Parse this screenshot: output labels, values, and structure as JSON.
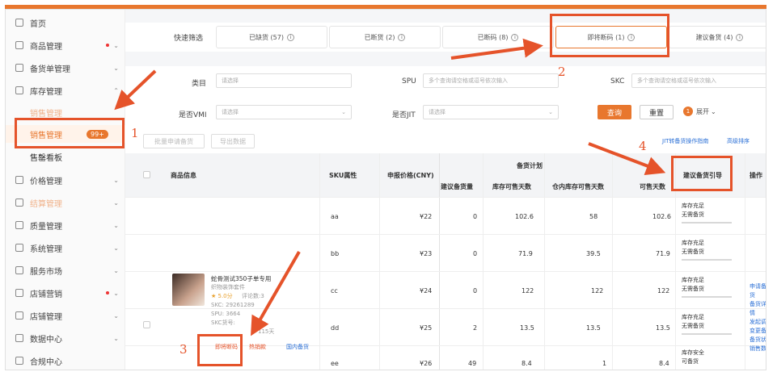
{
  "sidebar": {
    "items": [
      {
        "label": "首页",
        "chevron": false,
        "dot": false
      },
      {
        "label": "商品管理",
        "chevron": true,
        "dot": true
      },
      {
        "label": "备货单管理",
        "chevron": true,
        "dot": false
      },
      {
        "label": "库存管理",
        "chevron": true,
        "dot": false
      },
      {
        "label": "价格管理",
        "chevron": true,
        "dot": false
      },
      {
        "label": "结算管理",
        "chevron": true,
        "dot": false
      },
      {
        "label": "质量管理",
        "chevron": true,
        "dot": false
      },
      {
        "label": "系统管理",
        "chevron": true,
        "dot": false
      },
      {
        "label": "服务市场",
        "chevron": true,
        "dot": false
      },
      {
        "label": "店铺营销",
        "chevron": true,
        "dot": true
      },
      {
        "label": "店铺管理",
        "chevron": true,
        "dot": false
      },
      {
        "label": "数据中心",
        "chevron": true,
        "dot": false
      },
      {
        "label": "合规中心",
        "chevron": false,
        "dot": false
      }
    ],
    "sub_items": [
      "销售管理",
      "销售管理",
      "售罄看板"
    ],
    "sales_badge": "99+"
  },
  "quick_filter": {
    "label": "快速筛选",
    "tabs": [
      "已缺货 (57)",
      "已断货 (2)",
      "已断码 (8)",
      "即将断码 (1)",
      "建议备货 (4)"
    ],
    "active_index": 3
  },
  "filters": {
    "category_label": "类目",
    "category_placeholder": "请选择",
    "spu_label": "SPU",
    "spu_placeholder": "多个查询请空格或逗号依次输入",
    "skc_label": "SKC",
    "skc_placeholder": "多个查询请空格或逗号依次输入",
    "vmi_label": "是否VMI",
    "vmi_placeholder": "请选择",
    "jit_label": "是否JIT",
    "jit_placeholder": "请选择",
    "search_button": "查询",
    "reset_button": "重置",
    "expand_count": "1",
    "expand_label": "展开"
  },
  "actions": {
    "batch_button": "批量申请备货",
    "export_button": "导出数据",
    "jit_link": "JIT转备货操作指南",
    "sort_link": "高级排序"
  },
  "table": {
    "headers": {
      "product": "商品信息",
      "sku": "SKU属性",
      "price": "申报价格(CNY)",
      "plan": "备货计划",
      "suggest_qty": "建议备货量",
      "stock_days": "库存可售天数",
      "warehouse_days": "仓内库存可售天数",
      "sell_days": "可售天数",
      "guide": "建议备货引导",
      "ops": "操作"
    },
    "rows": [
      {
        "sku": "aa",
        "price": "¥22",
        "suggest": "0",
        "stock_days": "102.6",
        "wh_days": "58",
        "sell_days": "102.6",
        "guide1": "库存充足",
        "guide2": "无需备货"
      },
      {
        "sku": "bb",
        "price": "¥23",
        "suggest": "0",
        "stock_days": "71.9",
        "wh_days": "39.5",
        "sell_days": "71.9",
        "guide1": "库存充足",
        "guide2": "无需备货"
      },
      {
        "sku": "cc",
        "price": "¥24",
        "suggest": "0",
        "stock_days": "122",
        "wh_days": "122",
        "sell_days": "122",
        "guide1": "库存充足",
        "guide2": "无需备货"
      },
      {
        "sku": "dd",
        "price": "¥25",
        "suggest": "2",
        "stock_days": "13.5",
        "wh_days": "13.5",
        "sell_days": "13.5",
        "guide1": "库存充足",
        "guide2": "无需备货"
      },
      {
        "sku": "ee",
        "price": "¥26",
        "suggest": "49",
        "stock_days": "8.4",
        "wh_days": "1",
        "sell_days": "8.4",
        "guide1": "库存安全",
        "guide2": "可备货"
      }
    ],
    "product": {
      "title": "蛇骨测试350子单专用",
      "category": "织物装饰套件",
      "rating": "★ 5.0分",
      "reviews": "评论数:3",
      "skc": "SKC: 29261289",
      "spu": "SPU: 3664",
      "skc_code": "SKC货号:",
      "days": "115天",
      "tags": [
        "即将断码",
        "热销款",
        "国内备货"
      ]
    },
    "ops_links": [
      "申请备货",
      "备货详情",
      "发起调",
      "变更备",
      "备货状",
      "销售数"
    ]
  },
  "annotations": [
    "1",
    "2",
    "3",
    "4"
  ],
  "colors": {
    "accent": "#e8772e",
    "annotation": "#e5532a",
    "link": "#2a6fd6"
  }
}
